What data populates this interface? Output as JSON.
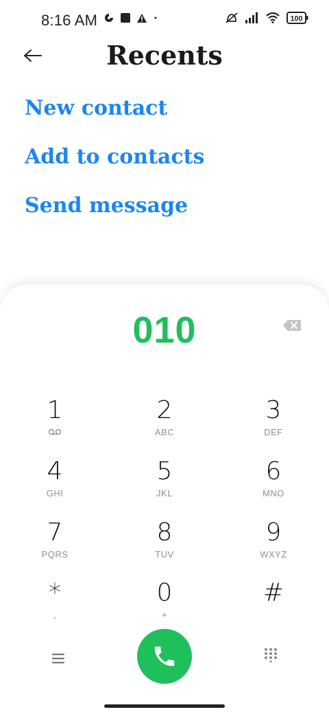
{
  "status_bar": {
    "time": "8:16 AM",
    "battery": "100"
  },
  "header": {
    "title": "Recents"
  },
  "actions": [
    {
      "label": "New contact"
    },
    {
      "label": "Add to contacts"
    },
    {
      "label": "Send message"
    }
  ],
  "dialer": {
    "number": "010",
    "keys": [
      {
        "digit": "1",
        "letters": ""
      },
      {
        "digit": "2",
        "letters": "ABC"
      },
      {
        "digit": "3",
        "letters": "DEF"
      },
      {
        "digit": "4",
        "letters": "GHI"
      },
      {
        "digit": "5",
        "letters": "JKL"
      },
      {
        "digit": "6",
        "letters": "MNO"
      },
      {
        "digit": "7",
        "letters": "PQRS"
      },
      {
        "digit": "8",
        "letters": "TUV"
      },
      {
        "digit": "9",
        "letters": "WXYZ"
      },
      {
        "digit": "*",
        "letters": ","
      },
      {
        "digit": "0",
        "letters": "+"
      },
      {
        "digit": "#",
        "letters": ""
      }
    ]
  },
  "colors": {
    "accent_blue": "#1c86ee",
    "accent_green": "#1fbf5b"
  },
  "icons": {
    "back": "arrow-left-icon",
    "backspace": "backspace-icon",
    "voicemail": "voicemail-icon",
    "menu": "menu-icon",
    "call": "phone-icon",
    "keypad": "dialpad-icon"
  }
}
